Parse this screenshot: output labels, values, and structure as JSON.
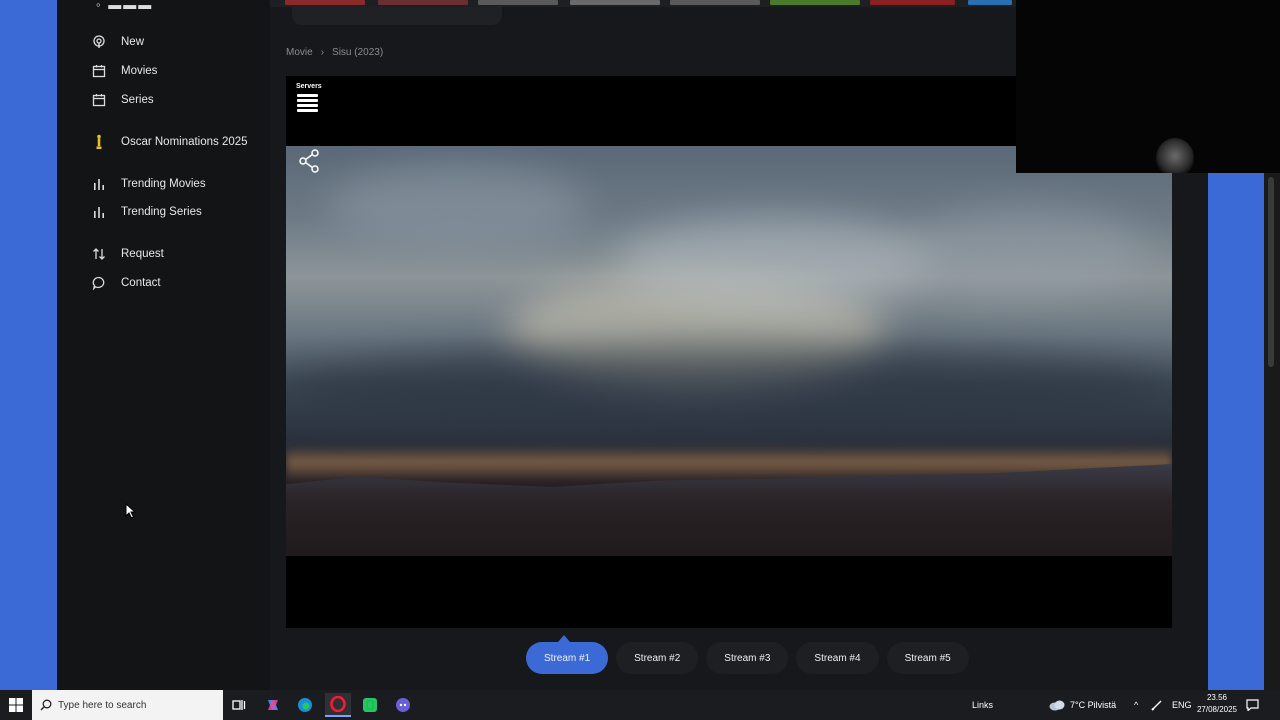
{
  "sidebar": {
    "items": [
      {
        "label": "New",
        "icon": "podcast-icon"
      },
      {
        "label": "Movies",
        "icon": "calendar-icon"
      },
      {
        "label": "Series",
        "icon": "calendar-icon"
      },
      {
        "label": "Oscar Nominations 2025",
        "icon": "oscar-statue-icon"
      },
      {
        "label": "Trending Movies",
        "icon": "bar-chart-icon"
      },
      {
        "label": "Trending Series",
        "icon": "bar-chart-icon"
      },
      {
        "label": "Request",
        "icon": "swap-arrows-icon"
      },
      {
        "label": "Contact",
        "icon": "chat-bubble-icon"
      }
    ]
  },
  "breadcrumb": {
    "root": "Movie",
    "current": "Sisu (2023)"
  },
  "player": {
    "servers_label": "Servers"
  },
  "streams": [
    {
      "label": "Stream #1",
      "active": true
    },
    {
      "label": "Stream #2",
      "active": false
    },
    {
      "label": "Stream #3",
      "active": false
    },
    {
      "label": "Stream #4",
      "active": false
    },
    {
      "label": "Stream #5",
      "active": false
    }
  ],
  "taskbar": {
    "search_placeholder": "Type here to search",
    "links_label": "Links",
    "weather": "7°C  Pilvistä",
    "language": "ENG",
    "time": "23.56",
    "date": "27/08/2025"
  },
  "colors": {
    "accent": "#3b6ad7",
    "oscar_gold": "#e6c229",
    "background": "#17181b"
  }
}
